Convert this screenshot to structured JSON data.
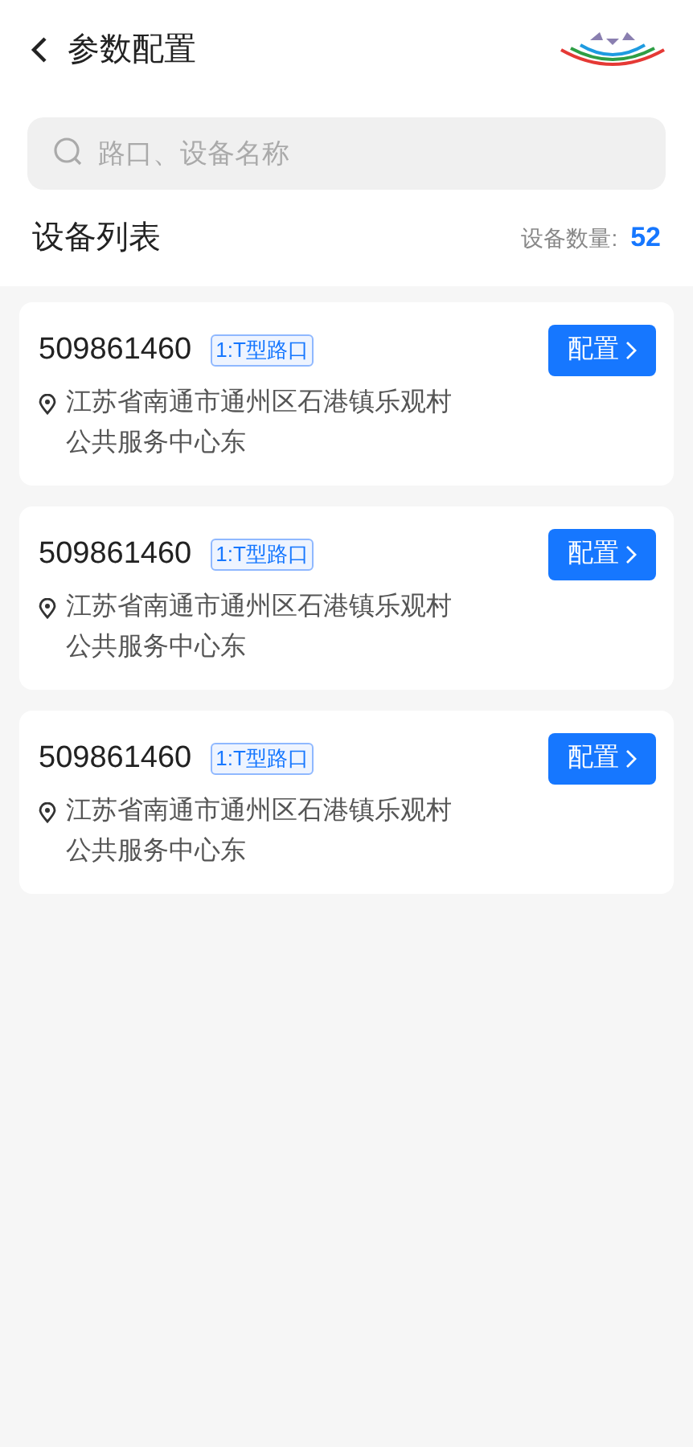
{
  "header": {
    "title": "参数配置"
  },
  "search": {
    "placeholder": "路口、设备名称"
  },
  "list_header": {
    "title": "设备列表",
    "count_label": "设备数量:",
    "count": "52"
  },
  "devices": [
    {
      "id": "509861460",
      "tag": "1:T型路口",
      "address": "江苏省南通市通州区石港镇乐观村公共服务中心东",
      "button": "配置"
    },
    {
      "id": "509861460",
      "tag": "1:T型路口",
      "address": "江苏省南通市通州区石港镇乐观村公共服务中心东",
      "button": "配置"
    },
    {
      "id": "509861460",
      "tag": "1:T型路口",
      "address": "江苏省南通市通州区石港镇乐观村公共服务中心东",
      "button": "配置"
    }
  ]
}
